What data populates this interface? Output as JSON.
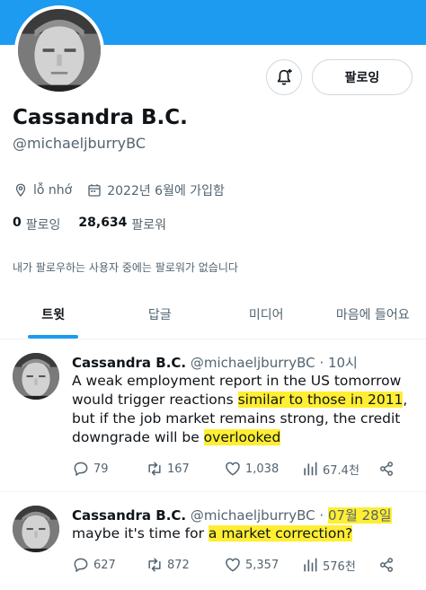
{
  "profile": {
    "display_name": "Cassandra B.C.",
    "handle": "@michaeljburryBC",
    "location": "lỗ nhớ",
    "joined": "2022년 6월에 가입함",
    "following_count": "0",
    "following_label": "팔로잉",
    "followers_count": "28,634",
    "followers_label": "팔로워",
    "follow_button": "팔로잉",
    "notice": "내가 팔로우하는 사용자 중에는 팔로워가 없습니다"
  },
  "tabs": [
    "트윗",
    "답글",
    "미디어",
    "마음에 들어요"
  ],
  "tweets": [
    {
      "name": "Cassandra B.C.",
      "handle": "@michaeljburryBC",
      "time": "· 10시",
      "text_a": "A weak employment report in the US tomorrow would trigger reactions ",
      "text_hl1": "similar to those in 2011",
      "text_b": ", but if the job market remains strong, the credit downgrade will be ",
      "text_hl2": "overlooked",
      "replies": "79",
      "retweets": "167",
      "likes": "1,038",
      "views": "67.4천"
    },
    {
      "name": "Cassandra B.C.",
      "handle": "@michaeljburryBC",
      "time_sep": " · ",
      "time": "07월 28일",
      "text_a": "maybe it's time for ",
      "text_hl1": "a market correction?",
      "replies": "627",
      "retweets": "872",
      "likes": "5,357",
      "views": "576천"
    }
  ],
  "colors": {
    "accent": "#1d9bf0",
    "highlight": "#ffee32",
    "muted": "#536471"
  }
}
